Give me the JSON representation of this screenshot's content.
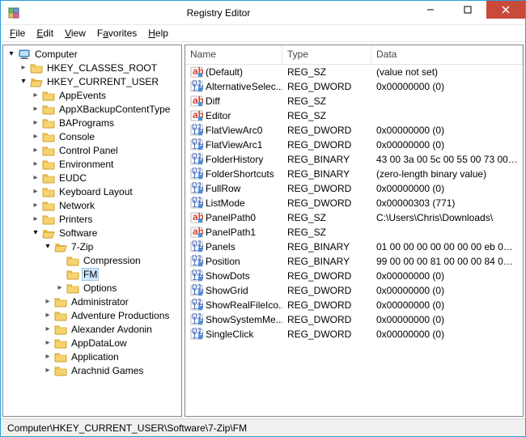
{
  "window": {
    "title": "Registry Editor"
  },
  "menu": {
    "file": "File",
    "edit": "Edit",
    "view": "View",
    "favorites": "Favorites",
    "help": "Help"
  },
  "status": {
    "path": "Computer\\HKEY_CURRENT_USER\\Software\\7-Zip\\FM"
  },
  "tree_root": "Computer",
  "hives": [
    "HKEY_CLASSES_ROOT",
    "HKEY_CURRENT_USER"
  ],
  "hkcu_children": [
    "AppEvents",
    "AppXBackupContentType",
    "BAPrograms",
    "Console",
    "Control Panel",
    "Environment",
    "EUDC",
    "Keyboard Layout",
    "Network",
    "Printers",
    "Software"
  ],
  "software_children_pre": [],
  "sevenzip": "7-Zip",
  "sevenzip_children": [
    "Compression",
    "FM",
    "Options"
  ],
  "software_children_post": [
    "Administrator",
    "Adventure Productions",
    "Alexander Avdonin",
    "AppDataLow",
    "Application",
    "Arachnid Games"
  ],
  "list_cols": {
    "name": "Name",
    "type": "Type",
    "data": "Data"
  },
  "values": [
    {
      "icon": "sz",
      "name": "(Default)",
      "type": "REG_SZ",
      "data": "(value not set)"
    },
    {
      "icon": "bin",
      "name": "AlternativeSelec...",
      "type": "REG_DWORD",
      "data": "0x00000000 (0)"
    },
    {
      "icon": "sz",
      "name": "Diff",
      "type": "REG_SZ",
      "data": ""
    },
    {
      "icon": "sz",
      "name": "Editor",
      "type": "REG_SZ",
      "data": ""
    },
    {
      "icon": "bin",
      "name": "FlatViewArc0",
      "type": "REG_DWORD",
      "data": "0x00000000 (0)"
    },
    {
      "icon": "bin",
      "name": "FlatViewArc1",
      "type": "REG_DWORD",
      "data": "0x00000000 (0)"
    },
    {
      "icon": "bin",
      "name": "FolderHistory",
      "type": "REG_BINARY",
      "data": "43 00 3a 00 5c 00 55 00 73 00 65 ..."
    },
    {
      "icon": "bin",
      "name": "FolderShortcuts",
      "type": "REG_BINARY",
      "data": "(zero-length binary value)"
    },
    {
      "icon": "bin",
      "name": "FullRow",
      "type": "REG_DWORD",
      "data": "0x00000000 (0)"
    },
    {
      "icon": "bin",
      "name": "ListMode",
      "type": "REG_DWORD",
      "data": "0x00000303 (771)"
    },
    {
      "icon": "sz",
      "name": "PanelPath0",
      "type": "REG_SZ",
      "data": "C:\\Users\\Chris\\Downloads\\"
    },
    {
      "icon": "sz",
      "name": "PanelPath1",
      "type": "REG_SZ",
      "data": ""
    },
    {
      "icon": "bin",
      "name": "Panels",
      "type": "REG_BINARY",
      "data": "01 00 00 00 00 00 00 00 eb 00 00 ..."
    },
    {
      "icon": "bin",
      "name": "Position",
      "type": "REG_BINARY",
      "data": "99 00 00 00 81 00 00 00 84 02 00 ..."
    },
    {
      "icon": "bin",
      "name": "ShowDots",
      "type": "REG_DWORD",
      "data": "0x00000000 (0)"
    },
    {
      "icon": "bin",
      "name": "ShowGrid",
      "type": "REG_DWORD",
      "data": "0x00000000 (0)"
    },
    {
      "icon": "bin",
      "name": "ShowRealFileIco...",
      "type": "REG_DWORD",
      "data": "0x00000000 (0)"
    },
    {
      "icon": "bin",
      "name": "ShowSystemMe...",
      "type": "REG_DWORD",
      "data": "0x00000000 (0)"
    },
    {
      "icon": "bin",
      "name": "SingleClick",
      "type": "REG_DWORD",
      "data": "0x00000000 (0)"
    }
  ]
}
